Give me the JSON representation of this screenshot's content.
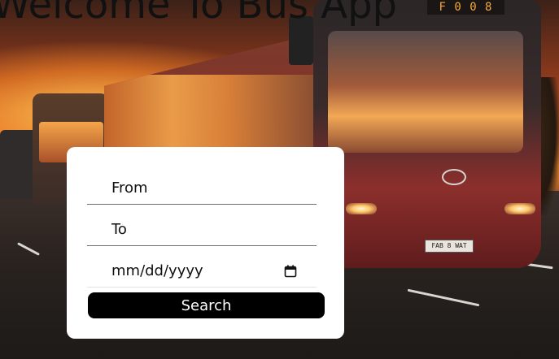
{
  "page": {
    "title": "Welcome To Bus App"
  },
  "hero": {
    "bus_sign": "F 0 0 8",
    "plate": "FAB 8 WAT"
  },
  "form": {
    "from_placeholder": "From",
    "to_placeholder": "To",
    "date_placeholder": "mm/dd/yyyy",
    "date_icon": "calendar-icon",
    "search_label": "Search"
  },
  "colors": {
    "button_bg": "#000000",
    "button_text": "#ffffff",
    "card_bg": "#ffffff",
    "title_text": "#111111"
  }
}
